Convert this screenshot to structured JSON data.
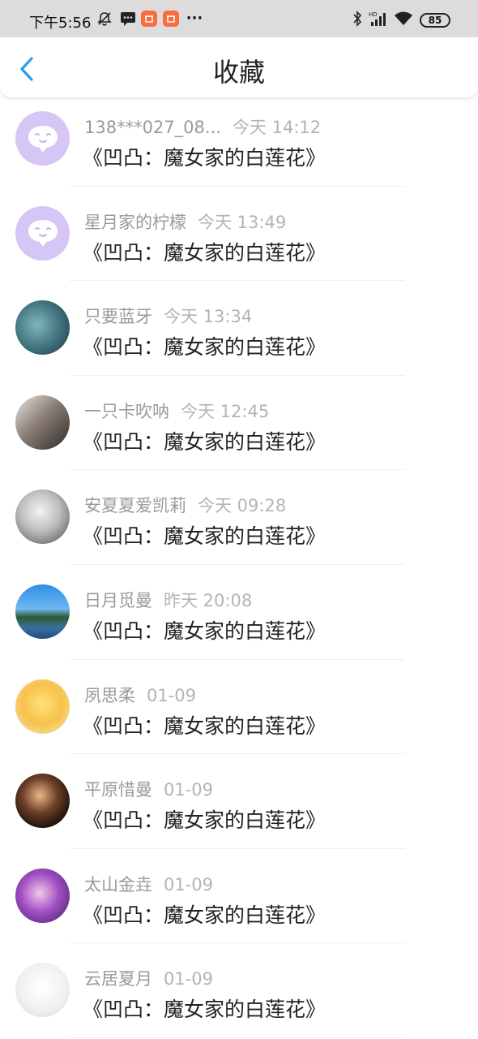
{
  "status_bar": {
    "time": "下午5:56",
    "battery": "85",
    "icons": [
      "mute-icon",
      "message-icon",
      "app-notification-icon",
      "app-notification-icon",
      "more-icon",
      "bluetooth-icon",
      "hd-signal-icon",
      "wifi-icon",
      "battery-icon"
    ]
  },
  "nav": {
    "title": "收藏",
    "back_icon": "chevron-left-icon",
    "accent": "#2aa0e6"
  },
  "items": [
    {
      "name": "138***027_08...",
      "time": "今天 14:12",
      "title": "《凹凸：魔女家的白莲花》",
      "avatar": "chat-bubble-icon"
    },
    {
      "name": "星月家的柠檬",
      "time": "今天 13:49",
      "title": "《凹凸：魔女家的白莲花》",
      "avatar": "chat-bubble-icon"
    },
    {
      "name": "只要蓝牙",
      "time": "今天 13:34",
      "title": "《凹凸：魔女家的白莲花》",
      "avatar": "user-avatar"
    },
    {
      "name": "一只卡吹呐",
      "time": "今天 12:45",
      "title": "《凹凸：魔女家的白莲花》",
      "avatar": "user-avatar"
    },
    {
      "name": "安夏夏爱凯莉",
      "time": "今天 09:28",
      "title": "《凹凸：魔女家的白莲花》",
      "avatar": "user-avatar"
    },
    {
      "name": "日月觅曼",
      "time": "昨天 20:08",
      "title": "《凹凸：魔女家的白莲花》",
      "avatar": "user-avatar"
    },
    {
      "name": "夙思柔",
      "time": "01-09",
      "title": "《凹凸：魔女家的白莲花》",
      "avatar": "user-avatar"
    },
    {
      "name": "平原惜曼",
      "time": "01-09",
      "title": "《凹凸：魔女家的白莲花》",
      "avatar": "user-avatar"
    },
    {
      "name": "太山金垚",
      "time": "01-09",
      "title": "《凹凸：魔女家的白莲花》",
      "avatar": "user-avatar"
    },
    {
      "name": "云居夏月",
      "time": "01-09",
      "title": "《凹凸：魔女家的白莲花》",
      "avatar": "user-avatar"
    }
  ]
}
